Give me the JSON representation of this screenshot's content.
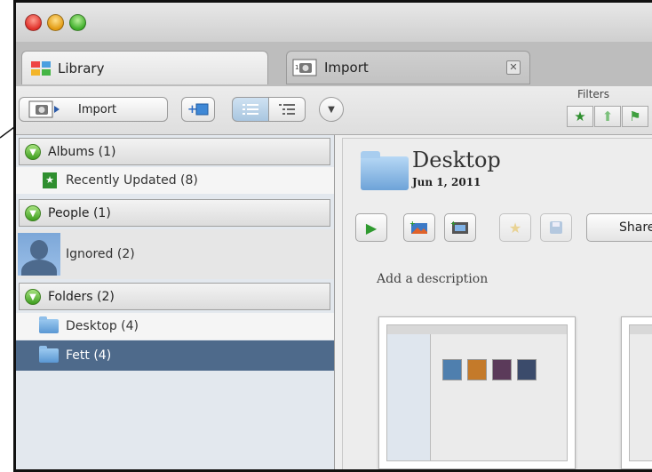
{
  "tabs": [
    {
      "label": "Library",
      "active": true,
      "icon": "library-icon"
    },
    {
      "label": "Import",
      "active": false,
      "icon": "camera-icon"
    }
  ],
  "toolbar": {
    "import_label": "Import",
    "filters_label": "Filters",
    "filters": [
      "star-filter-icon",
      "up-arrow-filter-icon",
      "person-filter-icon"
    ]
  },
  "sidebar": {
    "albums_header": "Albums (1)",
    "albums": [
      {
        "label": "Recently Updated (8)"
      }
    ],
    "people_header": "People (1)",
    "people": [
      {
        "label": "Ignored (2)"
      }
    ],
    "folders_header": "Folders (2)",
    "folders": [
      {
        "label": "Desktop (4)",
        "selected": false
      },
      {
        "label": "Fett (4)",
        "selected": true
      }
    ]
  },
  "main": {
    "event_title": "Desktop",
    "event_date": "Jun 1, 2011",
    "share_label": "Share",
    "description_placeholder": "Add a description"
  },
  "colors": {
    "selected_row": "#4e6a8b",
    "accent_green": "#3e9e1f"
  }
}
